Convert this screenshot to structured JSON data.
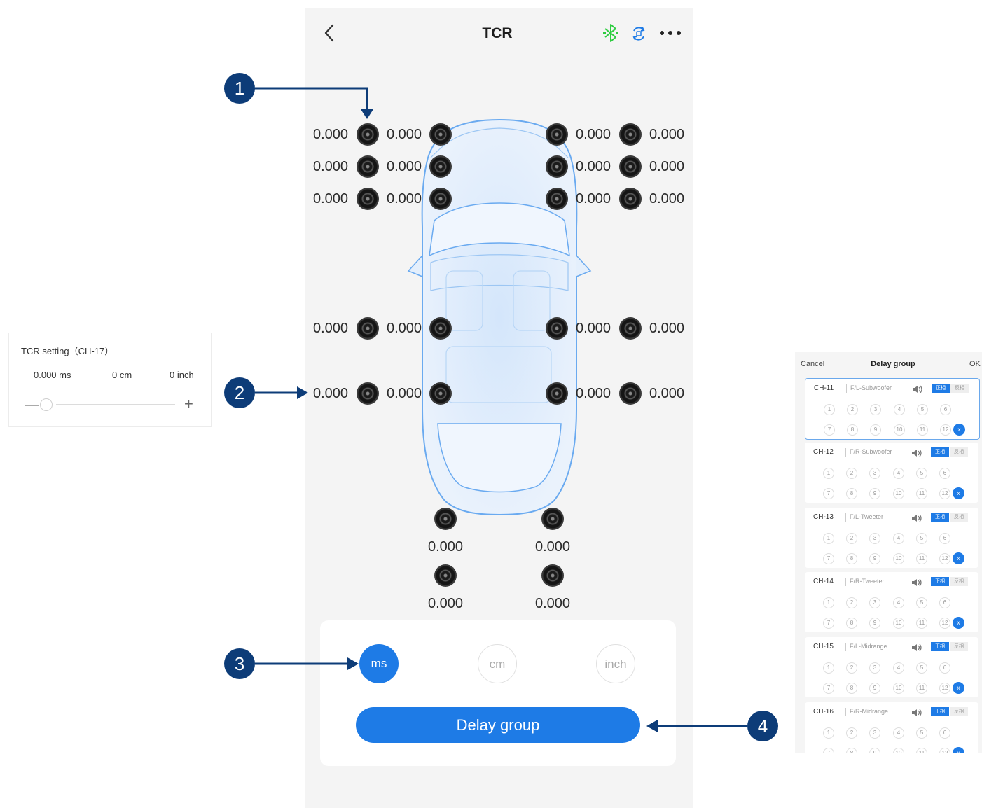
{
  "header": {
    "title": "TCR"
  },
  "speakers": {
    "row1": [
      "0.000",
      "0.000",
      "0.000",
      "0.000"
    ],
    "row2": [
      "0.000",
      "0.000",
      "0.000",
      "0.000"
    ],
    "row3": [
      "0.000",
      "0.000",
      "0.000",
      "0.000"
    ],
    "row4": [
      "0.000",
      "0.000",
      "0.000",
      "0.000"
    ],
    "row5": [
      "0.000",
      "0.000",
      "0.000",
      "0.000"
    ],
    "rear": [
      "0.000",
      "0.000",
      "0.000",
      "0.000"
    ]
  },
  "units": {
    "ms": "ms",
    "cm": "cm",
    "inch": "inch",
    "selected": "ms"
  },
  "delay_group_button": "Delay group",
  "callouts": [
    "1",
    "2",
    "3",
    "4"
  ],
  "tcr_setting": {
    "title": "TCR setting（CH-17）",
    "ms": "0.000 ms",
    "cm": "0 cm",
    "inch": "0 inch",
    "minus": "—",
    "plus": "+"
  },
  "delay_group": {
    "cancel": "Cancel",
    "title": "Delay group",
    "ok": "OK",
    "phase_pos": "正相",
    "phase_neg": "反相",
    "numbers": [
      "1",
      "2",
      "3",
      "4",
      "5",
      "6",
      "7",
      "8",
      "9",
      "10",
      "11",
      "12"
    ],
    "x": "x",
    "channels": [
      {
        "ch": "CH-11",
        "name": "F/L-Subwoofer"
      },
      {
        "ch": "CH-12",
        "name": "F/R-Subwoofer"
      },
      {
        "ch": "CH-13",
        "name": "F/L-Tweeter"
      },
      {
        "ch": "CH-14",
        "name": "F/R-Tweeter"
      },
      {
        "ch": "CH-15",
        "name": "F/L-Midrange"
      },
      {
        "ch": "CH-16",
        "name": "F/R-Midrange"
      }
    ]
  },
  "colors": {
    "accent": "#1e7be6",
    "callout": "#0d3c78",
    "bluetooth": "#2ecc40"
  }
}
